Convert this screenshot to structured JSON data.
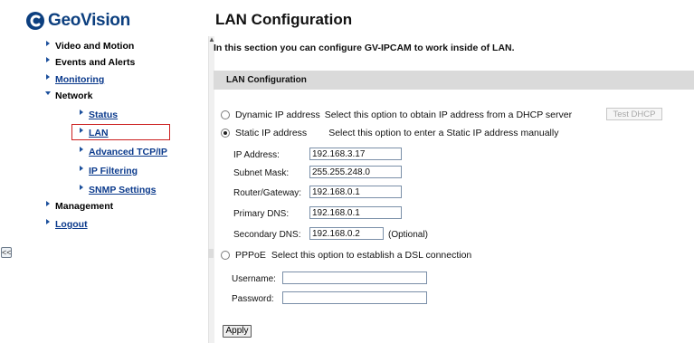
{
  "brand": {
    "name": "GeoVision"
  },
  "sidebar": {
    "items": [
      {
        "label": "Video and Motion",
        "link": false
      },
      {
        "label": "Events and Alerts",
        "link": false
      },
      {
        "label": "Monitoring",
        "link": true
      },
      {
        "label": "Network",
        "link": false,
        "expanded": true
      },
      {
        "label": "Status",
        "link": true
      },
      {
        "label": "LAN",
        "link": true,
        "selected": true
      },
      {
        "label": "Advanced TCP/IP",
        "link": true
      },
      {
        "label": "IP Filtering",
        "link": true
      },
      {
        "label": "SNMP Settings",
        "link": true
      },
      {
        "label": "Management",
        "link": false
      },
      {
        "label": "Logout",
        "link": true
      }
    ],
    "collapse_label": "<<"
  },
  "main": {
    "title": "LAN Configuration",
    "intro": "In this section you can configure GV-IPCAM to work inside of LAN.",
    "section_title": "LAN Configuration",
    "dynamic": {
      "label": "Dynamic IP address",
      "desc": "Select this option to obtain IP address from a DHCP server",
      "selected": false
    },
    "test_dhcp_label": "Test DHCP",
    "static": {
      "label": "Static IP address",
      "desc": "Select this option to enter a Static IP address manually",
      "selected": true
    },
    "fields": {
      "ip": {
        "label": "IP Address:",
        "value": "192.168.3.17"
      },
      "mask": {
        "label": "Subnet Mask:",
        "value": "255.255.248.0"
      },
      "gateway": {
        "label": "Router/Gateway:",
        "value": "192.168.0.1"
      },
      "dns1": {
        "label": "Primary DNS:",
        "value": "192.168.0.1"
      },
      "dns2": {
        "label": "Secondary DNS:",
        "value": "192.168.0.2",
        "note": "(Optional)"
      }
    },
    "pppoe": {
      "label": "PPPoE",
      "desc": "Select this option to establish a DSL connection",
      "selected": false,
      "username_label": "Username:",
      "username_value": "",
      "password_label": "Password:",
      "password_value": ""
    },
    "apply_label": "Apply"
  },
  "colors": {
    "brand": "#0c3f7f",
    "link": "#0b3a8c",
    "highlight": "#cc1f1f",
    "section_bar": "#dadada"
  }
}
